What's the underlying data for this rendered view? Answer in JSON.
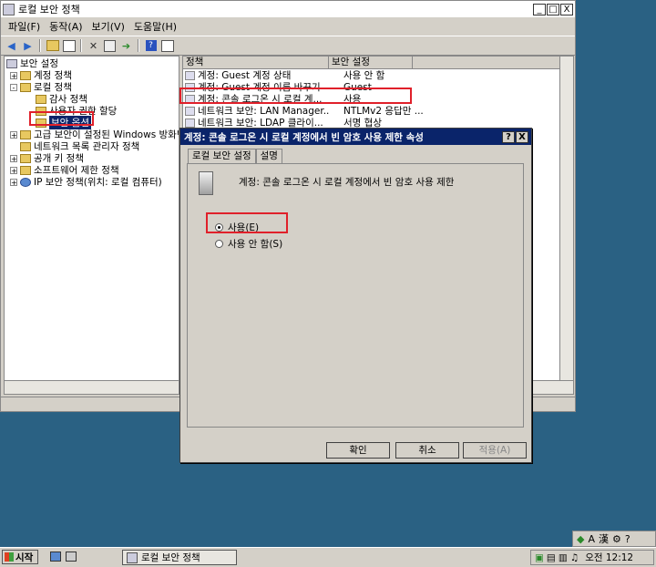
{
  "main_window": {
    "title": "로컬 보안 정책",
    "controls": {
      "minimize": "_",
      "maximize": "□",
      "close": "X"
    }
  },
  "menu": [
    "파일(F)",
    "동작(A)",
    "보기(V)",
    "도움말(H)"
  ],
  "toolbar_icons": [
    "back-icon",
    "forward-icon",
    "up-folder-icon",
    "tree-view-icon",
    "delete-icon",
    "properties-icon",
    "export-icon",
    "help-icon",
    "console-icon"
  ],
  "tree": {
    "root": "보안 설정",
    "items": [
      {
        "label": "계정 정책",
        "expand": "+"
      },
      {
        "label": "로컬 정책",
        "expand": "-"
      },
      {
        "label": "감사 정책"
      },
      {
        "label": "사용자 권한 할당"
      },
      {
        "label": "보안 옵션"
      },
      {
        "label": "고급 보안이 설정된 Windows 방화벽",
        "expand": "+"
      },
      {
        "label": "네트워크 목록 관리자 정책"
      },
      {
        "label": "공개 키 정책",
        "expand": "+"
      },
      {
        "label": "소프트웨어 제한 정책",
        "expand": "+"
      },
      {
        "label": "IP 보안 정책(위치: 로컬 컴퓨터)",
        "expand": "+"
      }
    ]
  },
  "list": {
    "headers": {
      "policy": "정책",
      "setting": "보안 설정"
    },
    "rows": [
      {
        "policy": "계정: Guest 계정 상태",
        "setting": "사용 안 함"
      },
      {
        "policy": "계정: Guest 계정 이름 바꾸기",
        "setting": "Guest"
      },
      {
        "policy": "계정: 콘솔 로그온 시 로컬 계...",
        "setting": "사용"
      },
      {
        "policy": "네트워크 보안: LAN Manager...",
        "setting": "NTLMv2 응답만 ..."
      },
      {
        "policy": "네트워크 보안: LDAP 클라이...",
        "setting": "서명 협상"
      }
    ]
  },
  "dialog": {
    "title": "계정: 콘솔 로그온 시 로컬 계정에서 빈 암호 사용 제한 속성",
    "help_btn": "?",
    "close_btn": "X",
    "tabs": [
      "로컬 보안 설정",
      "설명"
    ],
    "description": "계정: 콘솔 로그온 시 로컬 계정에서 빈 암호 사용 제한",
    "options": [
      {
        "label": "사용(E)",
        "selected": true
      },
      {
        "label": "사용 안 함(S)",
        "selected": false
      }
    ],
    "buttons": {
      "ok": "확인",
      "cancel": "취소",
      "apply": "적용(A)"
    }
  },
  "taskbar": {
    "start": "시작",
    "task": "로컬 보안 정책",
    "clock": "오전 12:12"
  },
  "language_bar": {
    "mode": "A",
    "hanja": "漢"
  },
  "colors": {
    "highlight": "#0a246a",
    "annotation_red": "#e0202a",
    "desktop": "#2a6183"
  }
}
